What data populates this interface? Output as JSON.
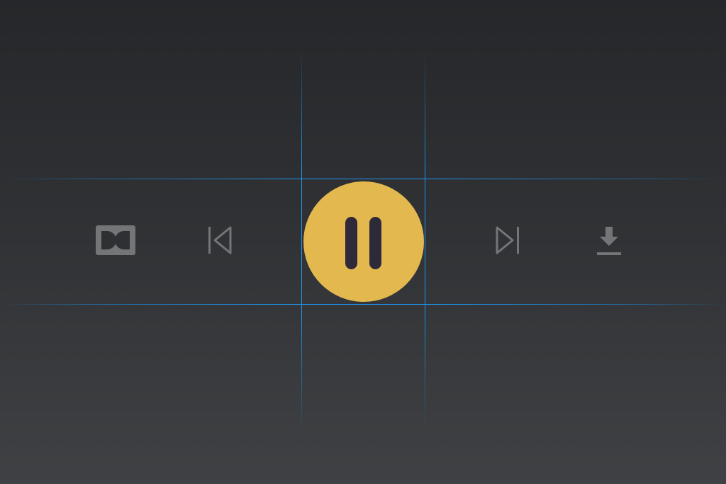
{
  "player": {
    "controls": [
      {
        "id": "dolby",
        "icon": "dolby-icon",
        "color": "#747577"
      },
      {
        "id": "previous",
        "icon": "skip-previous-icon",
        "color": "#747577"
      },
      {
        "id": "play_pause",
        "icon": "pause-icon",
        "state": "playing",
        "button_color": "#e2b84f",
        "icon_color": "#2f2a3a"
      },
      {
        "id": "next",
        "icon": "skip-next-icon",
        "color": "#747577"
      },
      {
        "id": "download",
        "icon": "download-icon",
        "color": "#747577"
      }
    ]
  },
  "guides": {
    "color": "#1e96f0",
    "horizontal_count": 2,
    "vertical_count": 2
  },
  "background": {
    "top_color": "#26272a",
    "bottom_color": "#3f4144"
  }
}
